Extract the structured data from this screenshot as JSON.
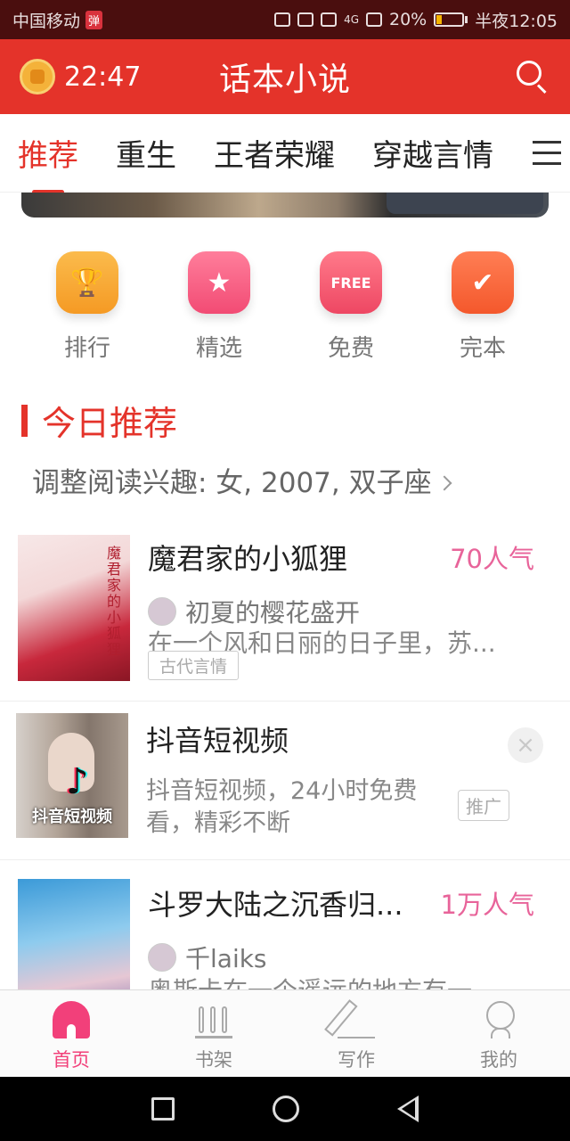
{
  "status_bar": {
    "carrier": "中国移动",
    "badge": "弹",
    "network": "4G",
    "battery": "20%",
    "battery_level": 0.2,
    "time": "半夜12:05"
  },
  "app_bar": {
    "timer": "22:47",
    "title": "话本小说"
  },
  "tabs": [
    "推荐",
    "重生",
    "王者荣耀",
    "穿越言情"
  ],
  "active_tab": 0,
  "quick_links": [
    {
      "label": "排行",
      "icon": "trophy-icon"
    },
    {
      "label": "精选",
      "icon": "star-icon"
    },
    {
      "label": "免费",
      "icon": "free-icon",
      "icon_text": "FREE"
    },
    {
      "label": "完本",
      "icon": "check-icon"
    }
  ],
  "section": {
    "title": "今日推荐",
    "interest": "调整阅读兴趣: 女, 2007, 双子座"
  },
  "books": [
    {
      "title": "魔君家的小狐狸",
      "popularity": "70人气",
      "author": "初夏的樱花盛开",
      "description": "在一个风和日丽的日子里，苏...",
      "tag": "古代言情",
      "cover_text": "魔君家的小狐狸"
    },
    {
      "title": "斗罗大陆之沉香归...",
      "popularity": "1万人气",
      "author": "千laiks",
      "description": "奥斯卡在一个遥远的地方有一"
    }
  ],
  "ad": {
    "title": "抖音短视频",
    "description": "抖音短视频，24小时免费看，精彩不断",
    "tag": "推广",
    "cover_text": "抖音短视频",
    "close": "×"
  },
  "bottom_nav": [
    {
      "label": "首页",
      "active": true
    },
    {
      "label": "书架",
      "active": false
    },
    {
      "label": "写作",
      "active": false
    },
    {
      "label": "我的",
      "active": false
    }
  ],
  "colors": {
    "brand_red": "#e4332a",
    "popularity_pink": "#e8649a",
    "nav_active": "#f2407a"
  }
}
